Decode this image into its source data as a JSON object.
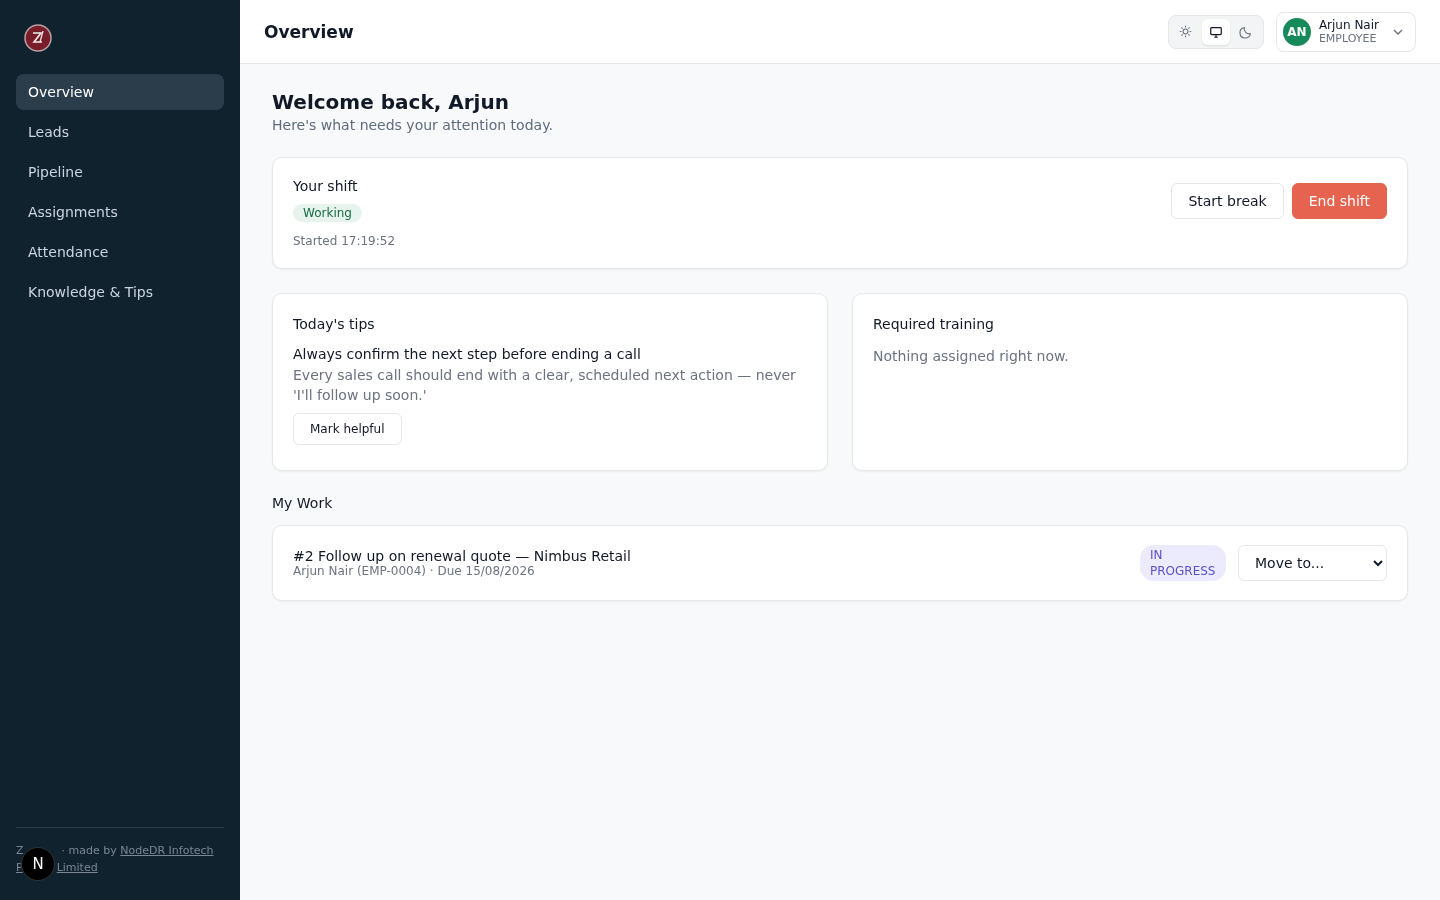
{
  "sidebar": {
    "items": [
      {
        "label": "Overview",
        "selected": true
      },
      {
        "label": "Leads",
        "selected": false
      },
      {
        "label": "Pipeline",
        "selected": false
      },
      {
        "label": "Assignments",
        "selected": false
      },
      {
        "label": "Attendance",
        "selected": false
      },
      {
        "label": "Knowledge & Tips",
        "selected": false
      }
    ],
    "footer": {
      "line1_start": "Z",
      "line1_middle": "· made by",
      "line1_link": "NodeDR Infotech",
      "line2_start": "P",
      "line2_link": "Limited"
    },
    "floating_badge": "N"
  },
  "header": {
    "title": "Overview",
    "theme_modes": [
      {
        "kind": "light",
        "selected": false
      },
      {
        "kind": "system",
        "selected": true
      },
      {
        "kind": "dark",
        "selected": false
      }
    ],
    "user": {
      "initials": "AN",
      "name": "Arjun Nair",
      "role": "EMPLOYEE"
    }
  },
  "welcome": {
    "title": "Welcome back, Arjun",
    "subtitle": "Here's what needs your attention today."
  },
  "shift": {
    "title": "Your shift",
    "status": "Working",
    "started": "Started 17:19:52",
    "buttons": [
      {
        "label": "Start break",
        "kind": "secondary"
      },
      {
        "label": "End shift",
        "kind": "danger"
      }
    ]
  },
  "tips": {
    "title": "Today's tips",
    "tip_title": "Always confirm the next step before ending a call",
    "tip_body": "Every sales call should end with a clear, scheduled next action — never 'I'll follow up soon.'",
    "button": "Mark helpful"
  },
  "training": {
    "title": "Required training",
    "empty": "Nothing assigned right now."
  },
  "my_work": {
    "title": "My Work",
    "items": [
      {
        "title": "#2 Follow up on renewal quote — Nimbus Retail",
        "meta": "Arjun Nair (EMP-0004) · Due 15/08/2026",
        "status": "IN PROGRESS",
        "action": "Move to..."
      }
    ]
  }
}
